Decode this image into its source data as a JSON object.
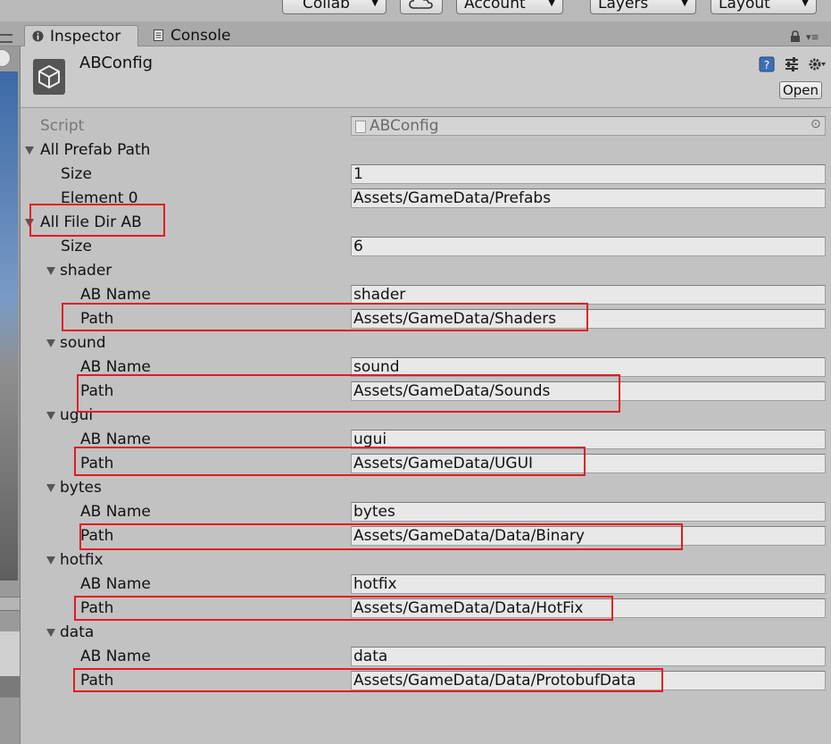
{
  "toolbar": {
    "collab_label": "Collab",
    "account_label": "Account",
    "layers_label": "Layers",
    "layout_label": "Layout"
  },
  "tabs": [
    {
      "label": "Inspector",
      "active": true
    },
    {
      "label": "Console",
      "active": false
    }
  ],
  "inspector": {
    "title": "ABConfig",
    "open_label": "Open",
    "script_label": "Script",
    "script_value": "ABConfig"
  },
  "prefab_list": {
    "label": "All Prefab Path",
    "size_label": "Size",
    "size_value": "1",
    "elements": [
      {
        "label": "Element 0",
        "value": "Assets/GameData/Prefabs"
      }
    ]
  },
  "file_dir_ab": {
    "label": "All File Dir AB",
    "size_label": "Size",
    "size_value": "6",
    "ab_name_label": "AB Name",
    "path_label": "Path",
    "entries": [
      {
        "name": "shader",
        "ab_name": "shader",
        "path": "Assets/GameData/Shaders"
      },
      {
        "name": "sound",
        "ab_name": "sound",
        "path": "Assets/GameData/Sounds"
      },
      {
        "name": "ugui",
        "ab_name": "ugui",
        "path": "Assets/GameData/UGUI"
      },
      {
        "name": "bytes",
        "ab_name": "bytes",
        "path": "Assets/GameData/Data/Binary"
      },
      {
        "name": "hotfix",
        "ab_name": "hotfix",
        "path": "Assets/GameData/Data/HotFix"
      },
      {
        "name": "data",
        "ab_name": "data",
        "path": "Assets/GameData/Data/ProtobufData"
      }
    ]
  },
  "colors": {
    "highlight": "#e01b24",
    "panel_bg": "#c2c2c2"
  }
}
